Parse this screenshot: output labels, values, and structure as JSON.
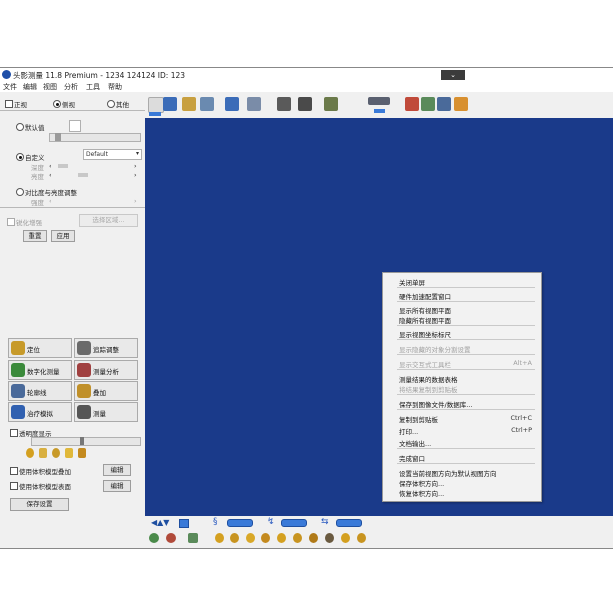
{
  "window": {
    "title": "头影测量 11.8 Premium - 1234 124124 ID: 123",
    "minimize_glyph": "⌄"
  },
  "menu": [
    "文件",
    "编辑",
    "视图",
    "分析",
    "工具",
    "帮助"
  ],
  "left_panel": {
    "mode_label_1": "正视",
    "mode_label_2": "侧视",
    "mode_label_3": "其他",
    "option_1": "默认值",
    "option_2": "自定义",
    "dropdown_value": "Default",
    "row_label_1": "深度",
    "row_label_2": "亮度",
    "option_3": "对比度与亮度调整",
    "row_label_3": "强度",
    "check_label_1": "锐化增强",
    "select_button": "选择区域...",
    "reset_button": "重置",
    "apply_button": "应用",
    "tools": [
      {
        "label": "定位",
        "icon": "face-icon",
        "color": "#c79a2a"
      },
      {
        "label": "追踪调整",
        "icon": "ruler-icon",
        "color": "#6a6a6a"
      },
      {
        "label": "数字化测量",
        "icon": "digitize-icon",
        "color": "#3b8a3b"
      },
      {
        "label": "测量分析",
        "icon": "analysis-icon",
        "color": "#a04040"
      },
      {
        "label": "轮廓线",
        "icon": "profile-icon",
        "color": "#4a6a9a"
      },
      {
        "label": "叠加",
        "icon": "superimpose-icon",
        "color": "#c0902a"
      },
      {
        "label": "治疗模拟",
        "icon": "simulation-icon",
        "color": "#3060b0"
      },
      {
        "label": "测量",
        "icon": "caliper-icon",
        "color": "#555555"
      }
    ],
    "section_check": "透明度显示",
    "check_label_2": "使用体积模型叠加",
    "check_label_3": "使用体积模型表面",
    "edit_button_1": "编辑",
    "edit_button_2": "编辑",
    "save_button": "保存设置"
  },
  "context_menu": {
    "items": [
      {
        "label": "关闭单屏",
        "shortcut": "",
        "enabled": true
      },
      {
        "label": "硬件加速配置窗口",
        "shortcut": "",
        "enabled": true
      },
      {
        "label": "显示所有视图平面",
        "shortcut": "",
        "enabled": true
      },
      {
        "label": "隐藏所有视图平面",
        "shortcut": "",
        "enabled": true
      },
      {
        "label": "显示视图坐标标尺",
        "shortcut": "",
        "enabled": true
      },
      {
        "label": "显示隐藏的对象分割设置",
        "shortcut": "",
        "enabled": false
      },
      {
        "label": "显示交互式工具栏",
        "shortcut": "Alt+A",
        "enabled": false
      },
      {
        "label": "测量结果的数据表格",
        "shortcut": "",
        "enabled": true
      },
      {
        "label": "将结果复制到剪贴板",
        "shortcut": "",
        "enabled": false
      },
      {
        "label": "保存到图像文件/数据库...",
        "shortcut": "",
        "enabled": true
      },
      {
        "label": "复制到剪贴板",
        "shortcut": "Ctrl+C",
        "enabled": true
      },
      {
        "label": "打印...",
        "shortcut": "Ctrl+P",
        "enabled": true
      },
      {
        "label": "文档输出...",
        "shortcut": "",
        "enabled": true
      },
      {
        "label": "完成窗口",
        "shortcut": "",
        "enabled": true
      },
      {
        "label": "设置当前视图方向为默认视图方向",
        "shortcut": "",
        "enabled": true
      },
      {
        "label": "保存体积方向...",
        "shortcut": "",
        "enabled": true
      },
      {
        "label": "恢复体积方向...",
        "shortcut": "",
        "enabled": true
      }
    ]
  },
  "colors": {
    "viewport": "#1a3a8a",
    "accent": "#3a7ad8"
  }
}
